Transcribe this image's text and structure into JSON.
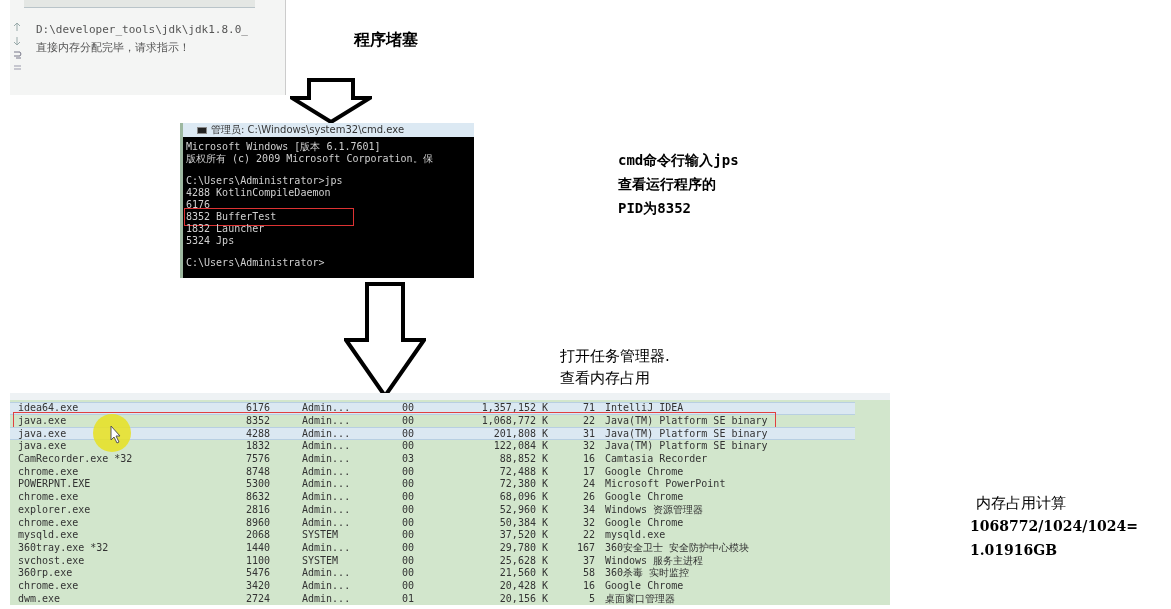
{
  "console": {
    "lines": [
      "D:\\developer_tools\\jdk\\jdk1.8.0_",
      "直接内存分配完毕，请求指示！"
    ]
  },
  "blocked_caption": "程序堵塞",
  "cmd_window": {
    "title": "管理员: C:\\Windows\\system32\\cmd.exe",
    "blocks": [
      {
        "lines": [
          {
            "text": "Microsoft Windows [版本 6.1.7601]",
            "boxed": false
          },
          {
            "text": "版权所有 (c) 2009 Microsoft Corporation。保",
            "boxed": false
          }
        ]
      },
      {
        "lines": [
          {
            "text": "C:\\Users\\Administrator>jps",
            "boxed": false
          },
          {
            "text": "4288 KotlinCompileDaemon",
            "boxed": false
          },
          {
            "text": "6176",
            "boxed": false
          },
          {
            "text": "8352 BufferTest",
            "boxed": true
          },
          {
            "text": "1832 Launcher",
            "boxed": false
          },
          {
            "text": "5324 Jps",
            "boxed": false
          }
        ]
      },
      {
        "lines": [
          {
            "text": "C:\\Users\\Administrator>",
            "boxed": false
          }
        ]
      }
    ]
  },
  "jps_note": [
    "cmd命令行输入jps",
    "查看运行程序的",
    "PID为8352"
  ],
  "task_manager_note": [
    "打开任务管理器.",
    "查看内存占用"
  ],
  "task_manager": {
    "rows": [
      {
        "cells": [
          "idea64.exe",
          "6176",
          "Admin...",
          "00",
          "1,357,152 K",
          "71",
          "IntelliJ IDEA"
        ],
        "selected": true,
        "boxed": false
      },
      {
        "cells": [
          "java.exe",
          "8352",
          "Admin...",
          "00",
          "1,068,772 K",
          "22",
          "Java(TM) Platform SE binary"
        ],
        "selected": false,
        "boxed": true
      },
      {
        "cells": [
          "java.exe",
          "4288",
          "Admin...",
          "00",
          "201,808 K",
          "31",
          "Java(TM) Platform SE binary"
        ],
        "selected": true,
        "boxed": false
      },
      {
        "cells": [
          "java.exe",
          "1832",
          "Admin...",
          "00",
          "122,084 K",
          "32",
          "Java(TM) Platform SE binary"
        ],
        "selected": false,
        "boxed": false
      },
      {
        "cells": [
          "CamRecorder.exe *32",
          "7576",
          "Admin...",
          "03",
          "88,852 K",
          "16",
          "Camtasia Recorder"
        ],
        "selected": false,
        "boxed": false
      },
      {
        "cells": [
          "chrome.exe",
          "8748",
          "Admin...",
          "00",
          "72,488 K",
          "17",
          "Google Chrome"
        ],
        "selected": false,
        "boxed": false
      },
      {
        "cells": [
          "POWERPNT.EXE",
          "5300",
          "Admin...",
          "00",
          "72,380 K",
          "24",
          "Microsoft PowerPoint"
        ],
        "selected": false,
        "boxed": false
      },
      {
        "cells": [
          "chrome.exe",
          "8632",
          "Admin...",
          "00",
          "68,096 K",
          "26",
          "Google Chrome"
        ],
        "selected": false,
        "boxed": false
      },
      {
        "cells": [
          "explorer.exe",
          "2816",
          "Admin...",
          "00",
          "52,960 K",
          "34",
          "Windows 资源管理器"
        ],
        "selected": false,
        "boxed": false
      },
      {
        "cells": [
          "chrome.exe",
          "8960",
          "Admin...",
          "00",
          "50,384 K",
          "32",
          "Google Chrome"
        ],
        "selected": false,
        "boxed": false
      },
      {
        "cells": [
          "mysqld.exe",
          "2068",
          "SYSTEM",
          "00",
          "37,520 K",
          "22",
          "mysqld.exe"
        ],
        "selected": false,
        "boxed": false
      },
      {
        "cells": [
          "360tray.exe *32",
          "1440",
          "Admin...",
          "00",
          "29,780 K",
          "167",
          "360安全卫士 安全防护中心模块"
        ],
        "selected": false,
        "boxed": false
      },
      {
        "cells": [
          "svchost.exe",
          "1100",
          "SYSTEM",
          "00",
          "25,628 K",
          "37",
          "Windows 服务主进程"
        ],
        "selected": false,
        "boxed": false
      },
      {
        "cells": [
          "360rp.exe",
          "5476",
          "Admin...",
          "00",
          "21,560 K",
          "58",
          "360杀毒 实时监控"
        ],
        "selected": false,
        "boxed": false
      },
      {
        "cells": [
          "chrome.exe",
          "3420",
          "Admin...",
          "00",
          "20,428 K",
          "16",
          "Google Chrome"
        ],
        "selected": false,
        "boxed": false
      },
      {
        "cells": [
          "dwm.exe",
          "2724",
          "Admin...",
          "01",
          "20,156 K",
          "5",
          "桌面窗口管理器"
        ],
        "selected": false,
        "boxed": false
      }
    ]
  },
  "calculation": {
    "title": "内存占用计算",
    "lines": [
      "1068772/1024/1024=",
      "1.01916GB"
    ]
  }
}
